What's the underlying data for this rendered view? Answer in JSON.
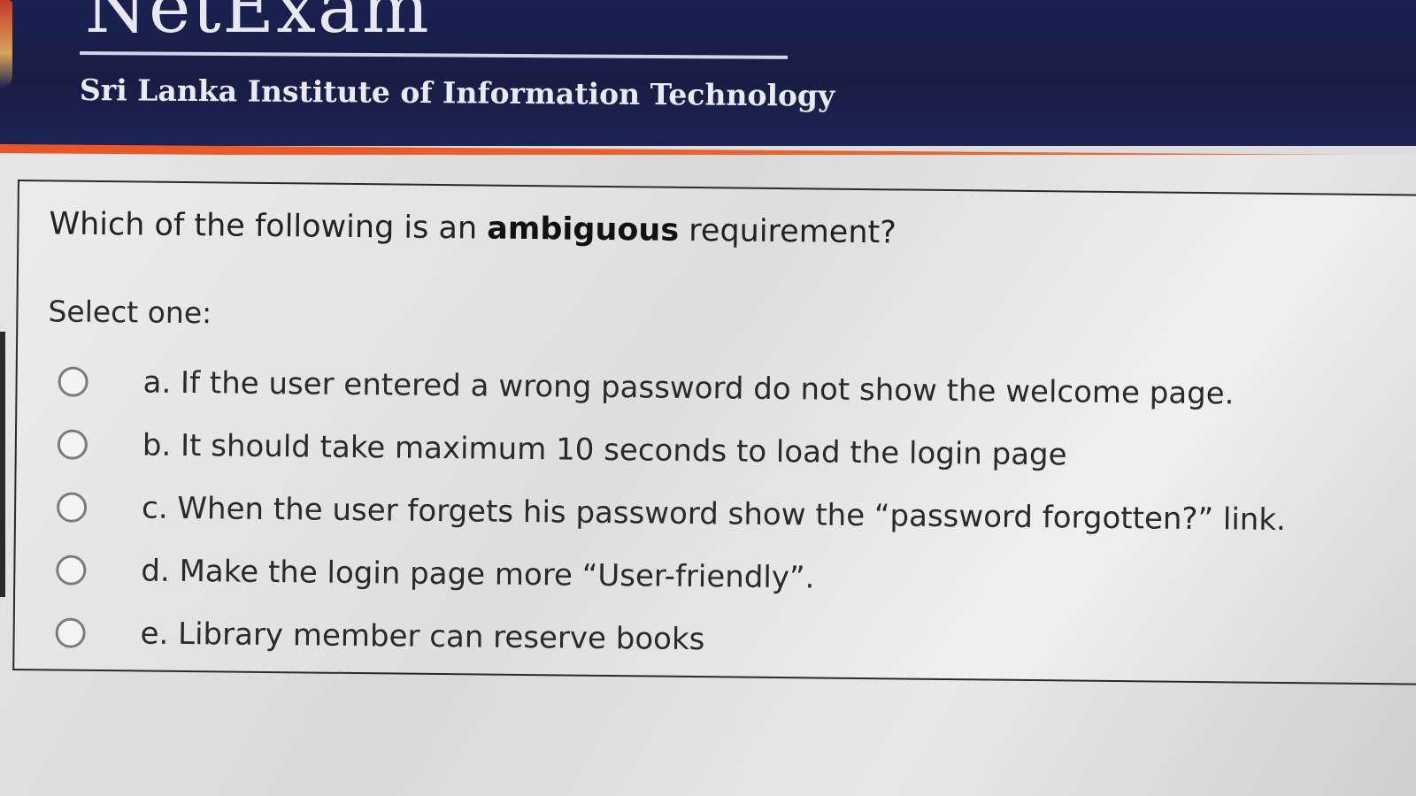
{
  "header": {
    "brand_text": "NetExam",
    "institute_name": "Sri Lanka Institute of Information Technology"
  },
  "question": {
    "text_before": "Which of the following is an ",
    "text_bold": "ambiguous",
    "text_after": " requirement?",
    "select_label": "Select one:",
    "options": [
      {
        "label": "a. If the user entered a wrong password do not show the welcome page."
      },
      {
        "label": "b. It should take maximum 10 seconds to load the login page"
      },
      {
        "label": "c. When the user forgets his password show the “password forgotten?” link."
      },
      {
        "label": "d. Make the login page more “User-friendly”."
      },
      {
        "label": "e. Library member can reserve books"
      }
    ]
  },
  "colors": {
    "header_bg": "#1b2150",
    "accent": "#e85528"
  }
}
